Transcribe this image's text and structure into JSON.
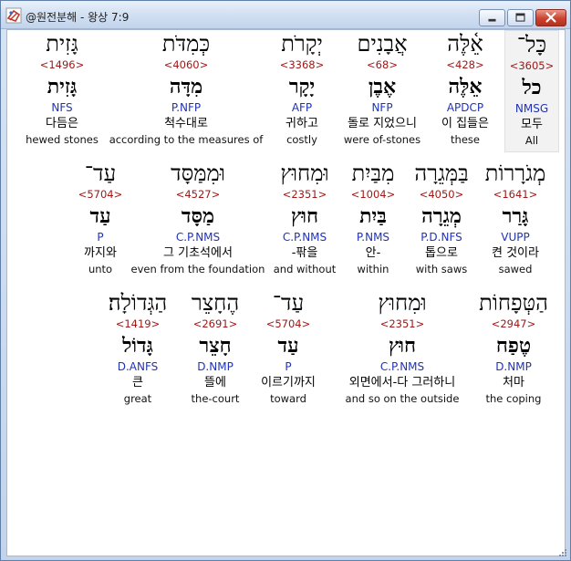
{
  "window": {
    "title": "@원전분해 - 왕상 7:9"
  },
  "rows": [
    [
      {
        "heb": "כָּל־",
        "num": "<3605>",
        "lex": "כל",
        "parse": "NMSG",
        "kor": "모두",
        "eng": "All"
      },
      {
        "heb": "אֵ֫לֶּה",
        "num": "<428>",
        "lex": "אֵלֶּה",
        "parse": "APDCP",
        "kor": "이 집들은",
        "eng": "these"
      },
      {
        "heb": "אֲבָנִים",
        "num": "<68>",
        "lex": "אֶבֶן",
        "parse": "NFP",
        "kor": "돌로 지었으니",
        "eng": "were of-stones"
      },
      {
        "heb": "יְקָרֹת",
        "num": "<3368>",
        "lex": "יָקָר",
        "parse": "AFP",
        "kor": "귀하고",
        "eng": "costly"
      },
      {
        "heb": "כְּמִדֹּת",
        "num": "<4060>",
        "lex": "מִדָּה",
        "parse": "P.NFP",
        "kor": "척수대로",
        "eng": "according to the measures of"
      },
      {
        "heb": "גָּזִית",
        "num": "<1496>",
        "lex": "גָּזִית",
        "parse": "NFS",
        "kor": "다듬은",
        "eng": "hewed stones"
      }
    ],
    [
      {
        "heb": "מְגֹרָרוֹת",
        "num": "<1641>",
        "lex": "גָּרַר",
        "parse": "VUPP",
        "kor": "켠 것이라",
        "eng": "sawed"
      },
      {
        "heb": "בַּמְּגֵרָה",
        "num": "<4050>",
        "lex": "מְגֵרָה",
        "parse": "P.D.NFS",
        "kor": "톱으로",
        "eng": "with saws"
      },
      {
        "heb": "מִבַּיִת",
        "num": "<1004>",
        "lex": "בַּיִת",
        "parse": "P.NMS",
        "kor": "안-",
        "eng": "within"
      },
      {
        "heb": "וּמִחוּץ",
        "num": "<2351>",
        "lex": "חוּץ",
        "parse": "C.P.NMS",
        "kor": "-팎을",
        "eng": "and without"
      },
      {
        "heb": "וּמִמַּסָּד",
        "num": "<4527>",
        "lex": "מַסָּד",
        "parse": "C.P.NMS",
        "kor": "그 기초석에서",
        "eng": "even from the foundation"
      },
      {
        "heb": "עַד־",
        "num": "<5704>",
        "lex": "עַד",
        "parse": "P",
        "kor": "까지와",
        "eng": "unto"
      }
    ],
    [
      {
        "heb": "הַטְּפָחוֹת",
        "num": "<2947>",
        "lex": "טֶפַח",
        "parse": "D.NMP",
        "kor": "처마",
        "eng": "the coping"
      },
      {
        "heb": "וּמִחוּץ",
        "num": "<2351>",
        "lex": "חוּץ",
        "parse": "C.P.NMS",
        "kor": "외면에서-다 그러하니",
        "eng": "and so on the outside"
      },
      {
        "heb": "עַד־",
        "num": "<5704>",
        "lex": "עַד",
        "parse": "P",
        "kor": "이르기까지",
        "eng": "toward"
      },
      {
        "heb": "הֶחָצֵר",
        "num": "<2691>",
        "lex": "חָצֵר",
        "parse": "D.NMP",
        "kor": "뜰에",
        "eng": "the-court"
      },
      {
        "heb": "הַגְּדוֹלָה׃",
        "num": "<1419>",
        "lex": "גָּדוֹל",
        "parse": "D.ANFS",
        "kor": "큰",
        "eng": "great"
      }
    ]
  ]
}
